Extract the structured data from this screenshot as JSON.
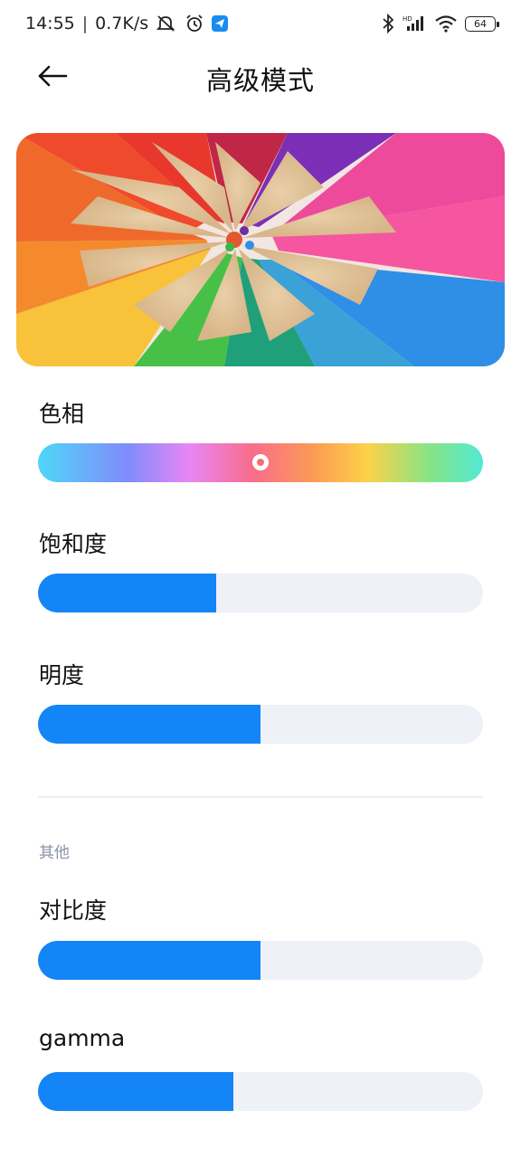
{
  "status_bar": {
    "time": "14:55",
    "separator": "|",
    "speed": "0.7K/s",
    "icons": [
      "mute-icon",
      "alarm-icon",
      "app-notification-icon",
      "bluetooth-icon",
      "signal-hd-icon",
      "wifi-icon"
    ],
    "battery": "64"
  },
  "header": {
    "title": "高级模式",
    "back_icon": "arrow-left-icon"
  },
  "hero": {
    "image": "colored-pencils-photo"
  },
  "controls": {
    "hue": {
      "label": "色相",
      "value": 0.5
    },
    "saturation": {
      "label": "饱和度",
      "value": 0.4
    },
    "brightness": {
      "label": "明度",
      "value": 0.5
    }
  },
  "other": {
    "section_title": "其他",
    "contrast": {
      "label": "对比度",
      "value": 0.5
    },
    "gamma": {
      "label": "gamma",
      "value": 0.44
    }
  },
  "colors": {
    "accent": "#1385f6",
    "track": "#eef1f8"
  }
}
